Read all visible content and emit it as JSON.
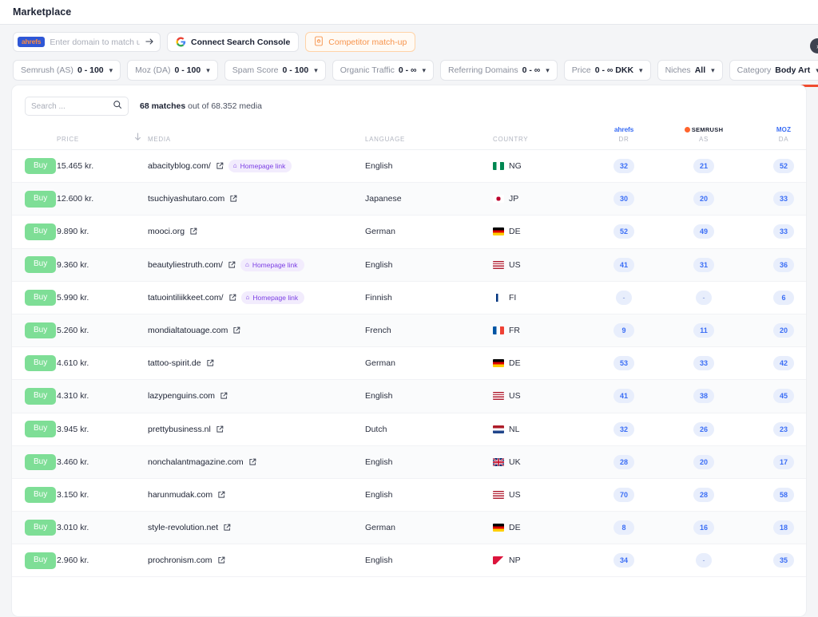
{
  "window": {
    "title": "Marketplace"
  },
  "toolbar": {
    "ahrefs_logo_text": "ahrefs",
    "domain_placeholder": "Enter domain to match up...",
    "domain_value": "",
    "submit_icon": "arrow-right-icon",
    "connect_search_console_label": "Connect Search Console",
    "competitor_matchup_label": "Competitor match-up"
  },
  "filters": [
    {
      "label": "Semrush (AS)",
      "value": "0 - 100",
      "highlighted": false
    },
    {
      "label": "Moz (DA)",
      "value": "0 - 100",
      "highlighted": false
    },
    {
      "label": "Spam Score",
      "value": "0 - 100",
      "highlighted": false
    },
    {
      "label": "Organic Traffic",
      "value": "0 - ∞",
      "highlighted": false
    },
    {
      "label": "Referring Domains",
      "value": "0 - ∞",
      "highlighted": false
    },
    {
      "label": "Price",
      "value": "0 - ∞ DKK",
      "highlighted": false
    },
    {
      "label": "Niches",
      "value": "All",
      "highlighted": false
    },
    {
      "label": "Category",
      "value": "Body Art",
      "highlighted": true
    }
  ],
  "filter_scroll_right_icon": "chevron-right-icon",
  "search": {
    "placeholder": "Search ...",
    "value": "",
    "icon": "search-icon"
  },
  "results": {
    "count_text": "68 matches",
    "total_text": "out of 68.352 media"
  },
  "table": {
    "headers": {
      "buy": "",
      "price": "PRICE",
      "sort_icon": "arrow-down-icon",
      "media": "MEDIA",
      "language": "LANGUAGE",
      "country": "COUNTRY",
      "dr_brand": "ahrefs",
      "dr_label": "DR",
      "as_brand": "SEMRUSH",
      "as_label": "AS",
      "da_brand": "MOZ",
      "da_label": "DA"
    },
    "buy_label": "Buy",
    "homepage_badge_label": "Homepage link",
    "rows": [
      {
        "price": "15.465 kr.",
        "media": "abacityblog.com/",
        "homepage": true,
        "language": "English",
        "country": "NG",
        "dr": "32",
        "as": "21",
        "da": "52"
      },
      {
        "price": "12.600 kr.",
        "media": "tsuchiyashutaro.com",
        "homepage": false,
        "language": "Japanese",
        "country": "JP",
        "dr": "30",
        "as": "20",
        "da": "33"
      },
      {
        "price": "9.890 kr.",
        "media": "mooci.org",
        "homepage": false,
        "language": "German",
        "country": "DE",
        "dr": "52",
        "as": "49",
        "da": "33"
      },
      {
        "price": "9.360 kr.",
        "media": "beautyliestruth.com/",
        "homepage": true,
        "language": "English",
        "country": "US",
        "dr": "41",
        "as": "31",
        "da": "36"
      },
      {
        "price": "5.990 kr.",
        "media": "tatuointiliikkeet.com/",
        "homepage": true,
        "language": "Finnish",
        "country": "FI",
        "dr": "-",
        "as": "-",
        "da": "6"
      },
      {
        "price": "5.260 kr.",
        "media": "mondialtatouage.com",
        "homepage": false,
        "language": "French",
        "country": "FR",
        "dr": "9",
        "as": "11",
        "da": "20"
      },
      {
        "price": "4.610 kr.",
        "media": "tattoo-spirit.de",
        "homepage": false,
        "language": "German",
        "country": "DE",
        "dr": "53",
        "as": "33",
        "da": "42"
      },
      {
        "price": "4.310 kr.",
        "media": "lazypenguins.com",
        "homepage": false,
        "language": "English",
        "country": "US",
        "dr": "41",
        "as": "38",
        "da": "45"
      },
      {
        "price": "3.945 kr.",
        "media": "prettybusiness.nl",
        "homepage": false,
        "language": "Dutch",
        "country": "NL",
        "dr": "32",
        "as": "26",
        "da": "23"
      },
      {
        "price": "3.460 kr.",
        "media": "nonchalantmagazine.com",
        "homepage": false,
        "language": "English",
        "country": "UK",
        "dr": "28",
        "as": "20",
        "da": "17"
      },
      {
        "price": "3.150 kr.",
        "media": "harunmudak.com",
        "homepage": false,
        "language": "English",
        "country": "US",
        "dr": "70",
        "as": "28",
        "da": "58"
      },
      {
        "price": "3.010 kr.",
        "media": "style-revolution.net",
        "homepage": false,
        "language": "German",
        "country": "DE",
        "dr": "8",
        "as": "16",
        "da": "18"
      },
      {
        "price": "2.960 kr.",
        "media": "prochronism.com",
        "homepage": false,
        "language": "English",
        "country": "NP",
        "dr": "34",
        "as": "-",
        "da": "35"
      }
    ]
  },
  "colors": {
    "buy_green": "#7ede96",
    "metric_blue": "#3b6ef5",
    "metric_bg": "#e8eefc",
    "badge_purple": "#7c3fe4",
    "accent_orange": "#f7944d",
    "highlight_red": "#f04b2f",
    "ahrefs_blue": "#2f57d6"
  }
}
